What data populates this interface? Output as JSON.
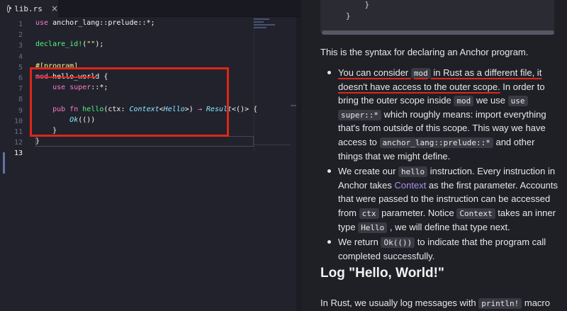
{
  "editor": {
    "tab": {
      "label": "lib.rs",
      "icon": "rust-icon",
      "close": "×"
    },
    "line_numbers": [
      "1",
      "2",
      "3",
      "4",
      "5",
      "6",
      "7",
      "8",
      "9",
      "10",
      "11",
      "12",
      "13"
    ],
    "lines": [
      {
        "parts": [
          [
            "kw",
            "use"
          ],
          [
            "pu",
            " anchor_lang::prelude::*;"
          ]
        ]
      },
      {
        "parts": []
      },
      {
        "parts": [
          [
            "fn",
            "declare_id!"
          ],
          [
            "pu",
            "("
          ],
          [
            "st",
            "\"\""
          ],
          [
            "pu",
            ");"
          ]
        ]
      },
      {
        "parts": []
      },
      {
        "parts": [
          [
            "at",
            "#[program]"
          ]
        ]
      },
      {
        "parts": [
          [
            "kw",
            "mod"
          ],
          [
            "pu",
            " hello_world {"
          ]
        ]
      },
      {
        "parts": [
          [
            "pu",
            "    "
          ],
          [
            "kw",
            "use"
          ],
          [
            "pu",
            " "
          ],
          [
            "kw",
            "super"
          ],
          [
            "pu",
            "::*;"
          ]
        ]
      },
      {
        "parts": []
      },
      {
        "parts": [
          [
            "pu",
            "    "
          ],
          [
            "kw",
            "pub fn"
          ],
          [
            "pu",
            " "
          ],
          [
            "fn",
            "hello"
          ],
          [
            "pu",
            "(ctx: "
          ],
          [
            "ty",
            "Context"
          ],
          [
            "pu",
            "<"
          ],
          [
            "ty",
            "Hello"
          ],
          [
            "pu",
            ">) "
          ],
          [
            "ar",
            "→"
          ],
          [
            "pu",
            " "
          ],
          [
            "ty",
            "Result"
          ],
          [
            "pu",
            "<()> {"
          ]
        ]
      },
      {
        "parts": [
          [
            "pu",
            "        "
          ],
          [
            "ty",
            "Ok"
          ],
          [
            "pu",
            "(())"
          ]
        ]
      },
      {
        "parts": [
          [
            "pu",
            "    }"
          ]
        ]
      },
      {
        "parts": [
          [
            "pu",
            "}"
          ]
        ]
      },
      {
        "parts": []
      }
    ]
  },
  "doc": {
    "codeblock_lines": [
      "    }",
      "}"
    ],
    "intro": "This is the syntax for declaring an Anchor program.",
    "bullets": [
      {
        "lines": [
          [
            [
              "u",
              "You can consider "
            ],
            [
              "uc",
              "mod"
            ],
            [
              "u",
              " in Rust as a different file, it"
            ]
          ],
          [
            [
              "u",
              "doesn't have access to the outer scope."
            ],
            [
              "t",
              " In order to"
            ]
          ],
          [
            [
              "t",
              "bring the outer scope inside "
            ],
            [
              "c",
              "mod"
            ],
            [
              "t",
              " we use "
            ],
            [
              "c",
              "use"
            ]
          ],
          [
            [
              "c",
              "super::*"
            ],
            [
              "t",
              " which roughly means: import everything"
            ]
          ],
          [
            [
              "t",
              "that's from outside of this scope. This way we have"
            ]
          ],
          [
            [
              "t",
              "access to "
            ],
            [
              "c",
              "anchor_lang::prelude::*"
            ],
            [
              "t",
              " and other"
            ]
          ],
          [
            [
              "t",
              "things that we might define."
            ]
          ]
        ]
      },
      {
        "lines": [
          [
            [
              "t",
              "We create our "
            ],
            [
              "c",
              "hello"
            ],
            [
              "t",
              " instruction. Every instruction in"
            ]
          ],
          [
            [
              "t",
              "Anchor takes "
            ],
            [
              "l",
              "Context"
            ],
            [
              "t",
              " as the first parameter. Accounts"
            ]
          ],
          [
            [
              "t",
              "that were passed to the instruction can be accessed"
            ]
          ],
          [
            [
              "t",
              "from "
            ],
            [
              "c",
              "ctx"
            ],
            [
              "t",
              " parameter. Notice "
            ],
            [
              "c",
              "Context"
            ],
            [
              "t",
              " takes an inner"
            ]
          ],
          [
            [
              "t",
              "type "
            ],
            [
              "c",
              "Hello"
            ],
            [
              "t",
              " , we will define that type next."
            ]
          ]
        ]
      },
      {
        "lines": [
          [
            [
              "t",
              "We return "
            ],
            [
              "c",
              "Ok(())"
            ],
            [
              "t",
              " to indicate that the program call"
            ]
          ],
          [
            [
              "t",
              "completed successfully."
            ]
          ]
        ]
      }
    ],
    "heading": "Log \"Hello, World!\"",
    "tail_parts": [
      [
        "t",
        "In Rust, we usually log messages with "
      ],
      [
        "c",
        "println!"
      ],
      [
        "t",
        " macro"
      ]
    ]
  },
  "colors": {
    "annotation": "#e0261a",
    "link": "#a990e8",
    "editor_bg": "#21222c",
    "doc_bg": "#1f2026"
  }
}
